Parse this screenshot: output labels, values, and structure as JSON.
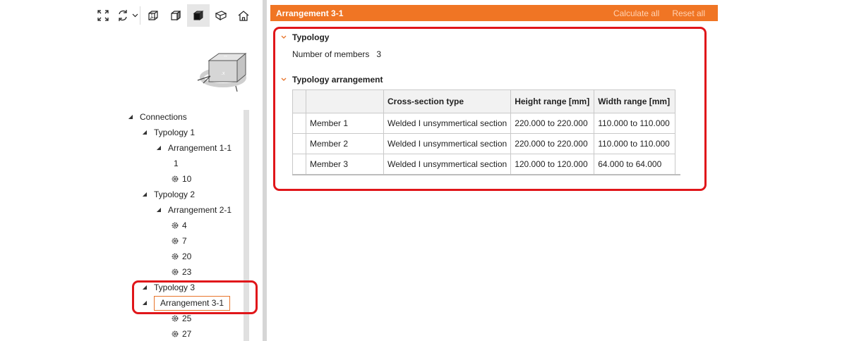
{
  "toolbar": {
    "icons": [
      "fit-view-icon",
      "rotate-view-icon",
      "chevron-down-icon",
      "wireframe-cube-icon",
      "shaded-cube-icon",
      "solid-cube-icon",
      "open-box-icon",
      "home-icon"
    ]
  },
  "tree": {
    "root": "Connections",
    "typology1": "Typology 1",
    "arrangement11": "Arrangement 1-1",
    "item1": "1",
    "item10": "10",
    "typology2": "Typology 2",
    "arrangement21": "Arrangement 2-1",
    "item4": "4",
    "item7": "7",
    "item20": "20",
    "item23": "23",
    "typology3": "Typology 3",
    "arrangement31": "Arrangement 3-1",
    "item25": "25",
    "item27": "27"
  },
  "panel": {
    "title": "Arrangement 3-1",
    "calculate_all": "Calculate all",
    "reset_all": "Reset all",
    "typology_section": "Typology",
    "number_of_members_label": "Number of members",
    "number_of_members_value": "3",
    "arrangement_section": "Typology arrangement",
    "table": {
      "headers": [
        "",
        "",
        "Cross-section type",
        "Height range [mm]",
        "Width range [mm]"
      ],
      "rows": [
        {
          "member": "Member 1",
          "type": "Welded I unsymmertical section",
          "height": "220.000 to 220.000",
          "width": "110.000 to 110.000"
        },
        {
          "member": "Member 2",
          "type": "Welded I unsymmertical section",
          "height": "220.000 to 220.000",
          "width": "110.000 to 110.000"
        },
        {
          "member": "Member 3",
          "type": "Welded I unsymmertical section",
          "height": "120.000 to 120.000",
          "width": "64.000 to 64.000"
        }
      ]
    }
  },
  "colors": {
    "accent": "#f07524",
    "highlight": "#e0161a",
    "selection_border": "#e8742a"
  }
}
